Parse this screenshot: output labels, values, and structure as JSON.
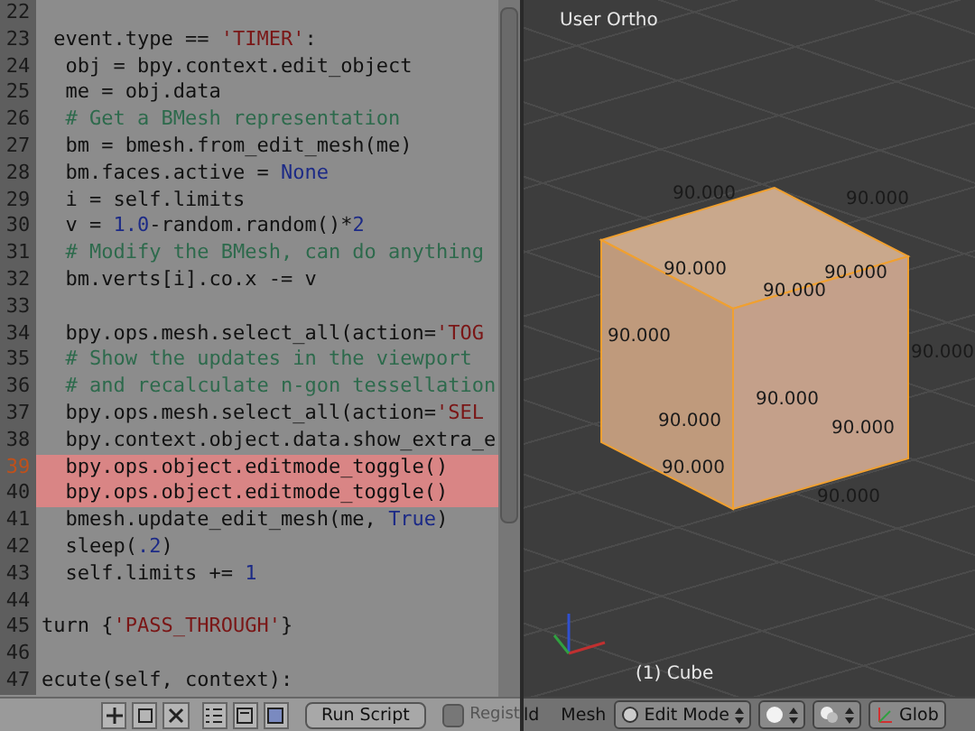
{
  "editor": {
    "lines": [
      {
        "number": "22",
        "highlighted": false,
        "current": false
      },
      {
        "number": "23",
        "highlighted": false,
        "current": false,
        "tokens": [
          {
            "kind": "plain",
            "text": " event.type == "
          },
          {
            "kind": "string",
            "text": "'TIMER'"
          },
          {
            "kind": "plain",
            "text": ":"
          }
        ]
      },
      {
        "number": "24",
        "highlighted": false,
        "current": false,
        "tokens": [
          {
            "kind": "plain",
            "text": "  obj = bpy.context.edit_object"
          }
        ]
      },
      {
        "number": "25",
        "highlighted": false,
        "current": false,
        "tokens": [
          {
            "kind": "plain",
            "text": "  me = obj.data"
          }
        ]
      },
      {
        "number": "26",
        "highlighted": false,
        "current": false,
        "tokens": [
          {
            "kind": "comment",
            "text": "  # Get a BMesh representation"
          }
        ]
      },
      {
        "number": "27",
        "highlighted": false,
        "current": false,
        "tokens": [
          {
            "kind": "plain",
            "text": "  bm = bmesh.from_edit_mesh(me)"
          }
        ]
      },
      {
        "number": "28",
        "highlighted": false,
        "current": false,
        "tokens": [
          {
            "kind": "plain",
            "text": "  bm.faces.active = "
          },
          {
            "kind": "number",
            "text": "None"
          }
        ]
      },
      {
        "number": "29",
        "highlighted": false,
        "current": false,
        "tokens": [
          {
            "kind": "plain",
            "text": "  i = self.limits"
          }
        ]
      },
      {
        "number": "30",
        "highlighted": false,
        "current": false,
        "tokens": [
          {
            "kind": "plain",
            "text": "  v = "
          },
          {
            "kind": "number",
            "text": "1.0"
          },
          {
            "kind": "plain",
            "text": "-random.random()*"
          },
          {
            "kind": "number",
            "text": "2"
          }
        ]
      },
      {
        "number": "31",
        "highlighted": false,
        "current": false,
        "tokens": [
          {
            "kind": "comment",
            "text": "  # Modify the BMesh, can do anything"
          }
        ]
      },
      {
        "number": "32",
        "highlighted": false,
        "current": false,
        "tokens": [
          {
            "kind": "plain",
            "text": "  bm.verts[i].co.x -= v"
          }
        ]
      },
      {
        "number": "33",
        "highlighted": false,
        "current": false
      },
      {
        "number": "34",
        "highlighted": false,
        "current": false,
        "tokens": [
          {
            "kind": "plain",
            "text": "  bpy.ops.mesh.select_all(action="
          },
          {
            "kind": "string",
            "text": "'TOG"
          }
        ]
      },
      {
        "number": "35",
        "highlighted": false,
        "current": false,
        "tokens": [
          {
            "kind": "comment",
            "text": "  # Show the updates in the viewport"
          }
        ]
      },
      {
        "number": "36",
        "highlighted": false,
        "current": false,
        "tokens": [
          {
            "kind": "comment",
            "text": "  # and recalculate n-gon tessellation"
          }
        ]
      },
      {
        "number": "37",
        "highlighted": false,
        "current": false,
        "tokens": [
          {
            "kind": "plain",
            "text": "  bpy.ops.mesh.select_all(action="
          },
          {
            "kind": "string",
            "text": "'SEL"
          }
        ]
      },
      {
        "number": "38",
        "highlighted": false,
        "current": false,
        "tokens": [
          {
            "kind": "plain",
            "text": "  bpy.context.object.data.show_extra_e"
          }
        ]
      },
      {
        "number": "39",
        "highlighted": true,
        "current": true,
        "tokens": [
          {
            "kind": "plain",
            "text": "  bpy.ops.object.editmode_toggle()"
          }
        ]
      },
      {
        "number": "40",
        "highlighted": true,
        "current": false,
        "tokens": [
          {
            "kind": "plain",
            "text": "  bpy.ops.object.editmode_toggle()"
          }
        ]
      },
      {
        "number": "41",
        "highlighted": false,
        "current": false,
        "tokens": [
          {
            "kind": "plain",
            "text": "  bmesh.update_edit_mesh(me, "
          },
          {
            "kind": "number",
            "text": "True"
          },
          {
            "kind": "plain",
            "text": ")"
          }
        ]
      },
      {
        "number": "42",
        "highlighted": false,
        "current": false,
        "tokens": [
          {
            "kind": "plain",
            "text": "  sleep("
          },
          {
            "kind": "number",
            "text": ".2"
          },
          {
            "kind": "plain",
            "text": ")"
          }
        ]
      },
      {
        "number": "43",
        "highlighted": false,
        "current": false,
        "tokens": [
          {
            "kind": "plain",
            "text": "  self.limits += "
          },
          {
            "kind": "number",
            "text": "1"
          }
        ]
      },
      {
        "number": "44",
        "highlighted": false,
        "current": false
      },
      {
        "number": "45",
        "highlighted": false,
        "current": false,
        "tokens": [
          {
            "kind": "plain",
            "text": "turn {"
          },
          {
            "kind": "string",
            "text": "'PASS_THROUGH'"
          },
          {
            "kind": "plain",
            "text": "}"
          }
        ]
      },
      {
        "number": "46",
        "highlighted": false,
        "current": false
      },
      {
        "number": "47",
        "highlighted": false,
        "current": false,
        "tokens": [
          {
            "kind": "plain",
            "text": "ecute(self, context):"
          }
        ]
      }
    ],
    "footer": {
      "run_button": "Run Script",
      "register": {
        "label": "Regist",
        "checked": false
      }
    }
  },
  "viewport": {
    "view_label": "User Ortho",
    "object_label": "(1) Cube",
    "edge_labels": [
      "90.000",
      "90.000",
      "90.000",
      "90.000",
      "90.000",
      "90.000",
      "90.000",
      "90.000",
      "90.000",
      "90.000",
      "90.000",
      "90.000"
    ],
    "header": {
      "cut_label": "ld",
      "menu": "Mesh",
      "mode": "Edit Mode",
      "orientation": "Glob"
    }
  }
}
